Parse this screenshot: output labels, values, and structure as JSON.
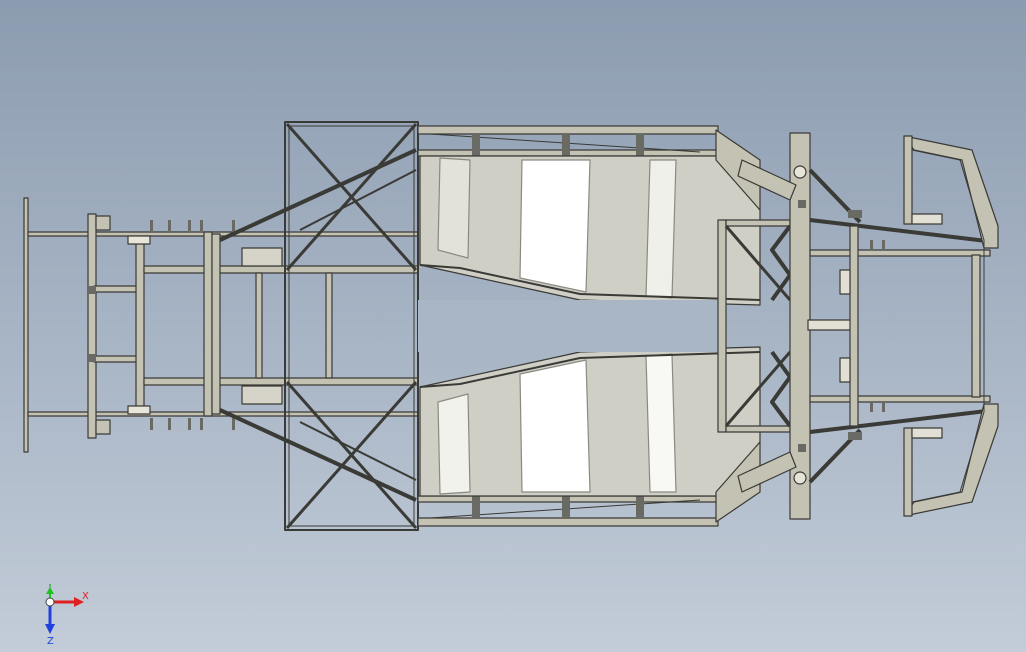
{
  "viewport": {
    "background_top": "#8c9cb0",
    "background_bottom": "#c3ccd8",
    "model": "chassis-frame-top-view"
  },
  "colors": {
    "tube": "#c4c2b3",
    "tube_edge": "#3a3a36",
    "panel": "#cfcfc6",
    "panel_light": "#ffffff",
    "axis_x": "#e02020",
    "axis_y": "#20c020",
    "axis_z": "#2040e0"
  },
  "triad": {
    "x_label": "X",
    "y_label": "Y",
    "z_label": "Z"
  }
}
